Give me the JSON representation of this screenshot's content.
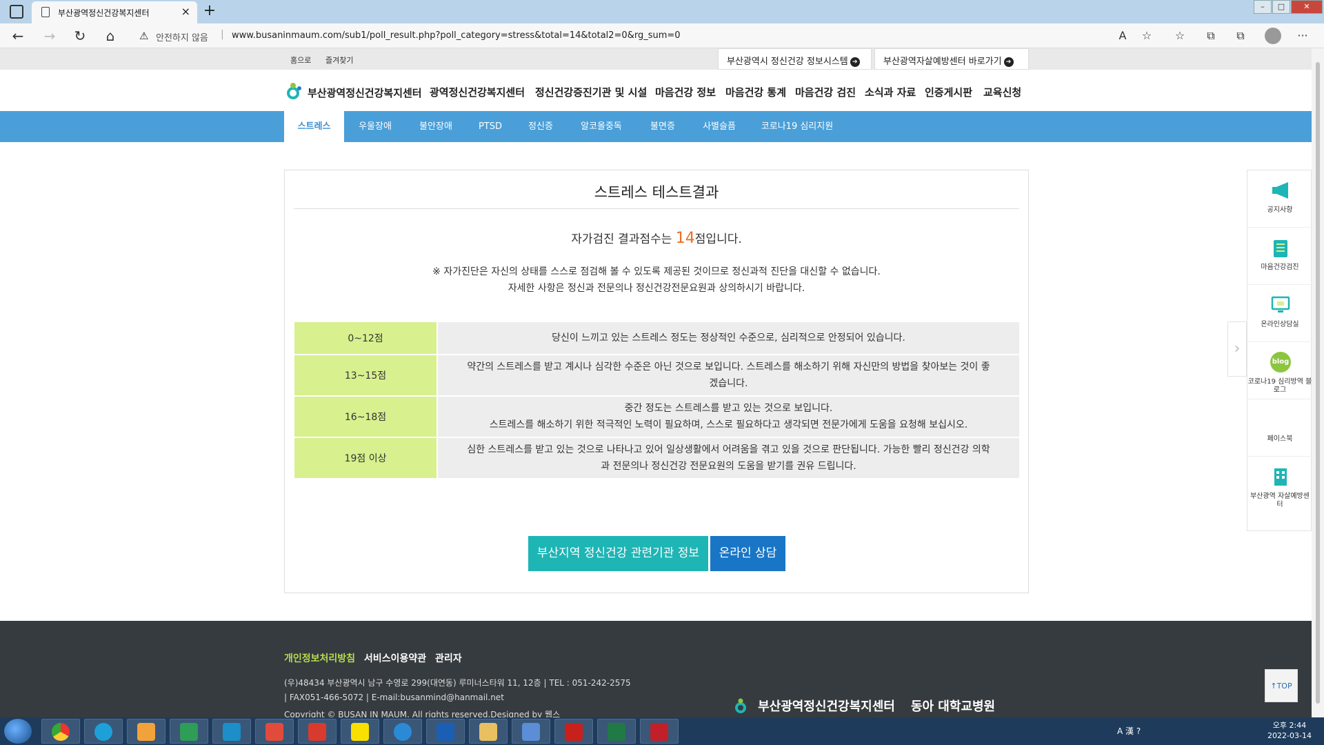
{
  "browser": {
    "tab_title": "부산광역정신건강복지센터",
    "tab_close": "×",
    "new_tab": "+",
    "security_label": "안전하지 않음",
    "url": "www.busaninmaum.com/sub1/poll_result.php?poll_category=stress&total=14&total2=0&rg_sum=0",
    "nav": {
      "back": "←",
      "forward": "→",
      "refresh": "↻",
      "home": "⌂"
    },
    "tools": {
      "read_aloud": "A",
      "favorite": "☆",
      "favorites": "☆",
      "collections": "⧉",
      "extensions": "⧉",
      "more": "···"
    }
  },
  "topbar": {
    "home": "홈으로",
    "bookmark": "즐겨찾기",
    "quick_links": [
      "부산광역시 정신건강 정보시스템",
      "부산광역자살예방센터 바로가기"
    ],
    "arrow": "➔"
  },
  "header": {
    "logo_text": "부산광역정신건강복지센터",
    "gnb": [
      "광역정신건강복지센터",
      "정신건강증진기관 및 시설",
      "마음건강 정보",
      "마음건강 통계",
      "마음건강 검진",
      "소식과 자료",
      "인증게시판",
      "교육신청"
    ]
  },
  "subnav": {
    "items": [
      "스트레스",
      "우울장애",
      "불안장애",
      "PTSD",
      "정신증",
      "알코올중독",
      "불면증",
      "사별슬픔",
      "코로나19 심리지원"
    ],
    "active": "스트레스"
  },
  "result": {
    "title": "스트레스 테스트결과",
    "score_prefix": "자가검진 결과점수는 ",
    "score": "14",
    "score_suffix": "점입니다.",
    "notice_line1": "※ 자가진단은 자신의 상태를 스스로 점검해 볼 수 있도록 제공된 것이므로 정신과적 진단을 대신할 수 없습니다.",
    "notice_line2": "자세한 사항은 정신과 전문의나 정신건강전문요원과 상의하시기 바랍니다.",
    "table": [
      {
        "range": "0~12점",
        "desc": [
          "당신이 느끼고 있는 스트레스 정도는 정상적인 수준으로, 심리적으로 안정되어 있습니다."
        ]
      },
      {
        "range": "13~15점",
        "desc": [
          "약간의 스트레스를 받고 계시나 심각한 수준은 아닌 것으로 보입니다. 스트레스를 해소하기 위해 자신만의 방법을 찾아보는 것이 좋",
          "겠습니다."
        ]
      },
      {
        "range": "16~18점",
        "desc": [
          "중간 정도는 스트레스를 받고 있는 것으로 보입니다.",
          "스트레스를 해소하기 위한 적극적인 노력이 필요하며, 스스로 필요하다고 생각되면 전문가에게 도움을 요청해 보십시오."
        ]
      },
      {
        "range": "19점 이상",
        "desc": [
          "심한 스트레스를 받고 있는 것으로 나타나고 있어 일상생활에서 어려움을 겪고 있을 것으로 판단됩니다. 가능한 빨리 정신건강 의학",
          "과 전문의나 정신건강 전문요원의 도움을 받기를 권유 드립니다."
        ]
      }
    ],
    "btn_info": "부산지역 정신건강 관련기관 정보",
    "btn_consult": "온라인 상담"
  },
  "quick_menu": {
    "items": [
      "공지사항",
      "마음건강검진",
      "온라인상담실",
      "코로나19 심리방역 블로그",
      "페이스북",
      "부산광역 자살예방센터"
    ],
    "blog_badge": "blog",
    "arrow": "›"
  },
  "footer": {
    "links": [
      "개인정보처리방침",
      "서비스이용약관",
      "관리자"
    ],
    "address": "(우)48434 부산광역시 남구 수영로 299(대연동) 루미너스타워 11, 12층 | TEL : 051-242-2575",
    "contact": "| FAX051-466-5072 | E-mail:busanmind@hanmail.net",
    "copyright": "Copyright © BUSAN IN MAUM. All rights reserved.Designed by 웹스",
    "logo_text": "부산광역정신건강복지센터",
    "hospital": "동아 대학교병원",
    "top_button": "↑TOP"
  },
  "taskbar": {
    "time": "오후 2:44",
    "date": "2022-03-14",
    "tray": "A 漢 ?"
  },
  "colors": {
    "subnav_bg": "#4a9fd8",
    "score": "#ee6d1f",
    "range_bg": "#d8f08e",
    "btn_info": "#1eb5b5",
    "btn_consult": "#1976c6",
    "footer_bg": "#363b3f",
    "footer_link": "#b6dc4c"
  }
}
